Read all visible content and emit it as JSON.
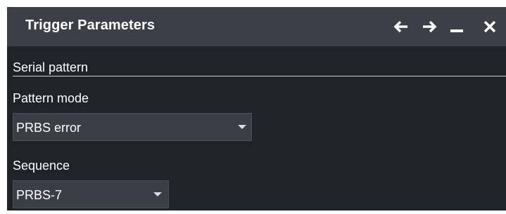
{
  "window": {
    "title": "Trigger Parameters",
    "buttons": {
      "back_icon": "arrow-left-icon",
      "forward_icon": "arrow-right-icon",
      "minimize_icon": "minimize-icon",
      "close_icon": "close-icon"
    }
  },
  "section": {
    "heading": "Serial pattern"
  },
  "pattern_mode": {
    "label": "Pattern mode",
    "selected": "PRBS error"
  },
  "sequence": {
    "label": "Sequence",
    "selected": "PRBS-7"
  },
  "colors": {
    "titlebar": "#3b4047",
    "panel": "#1e2328",
    "dropdown": "#3a3f45",
    "text": "#ffffff"
  }
}
